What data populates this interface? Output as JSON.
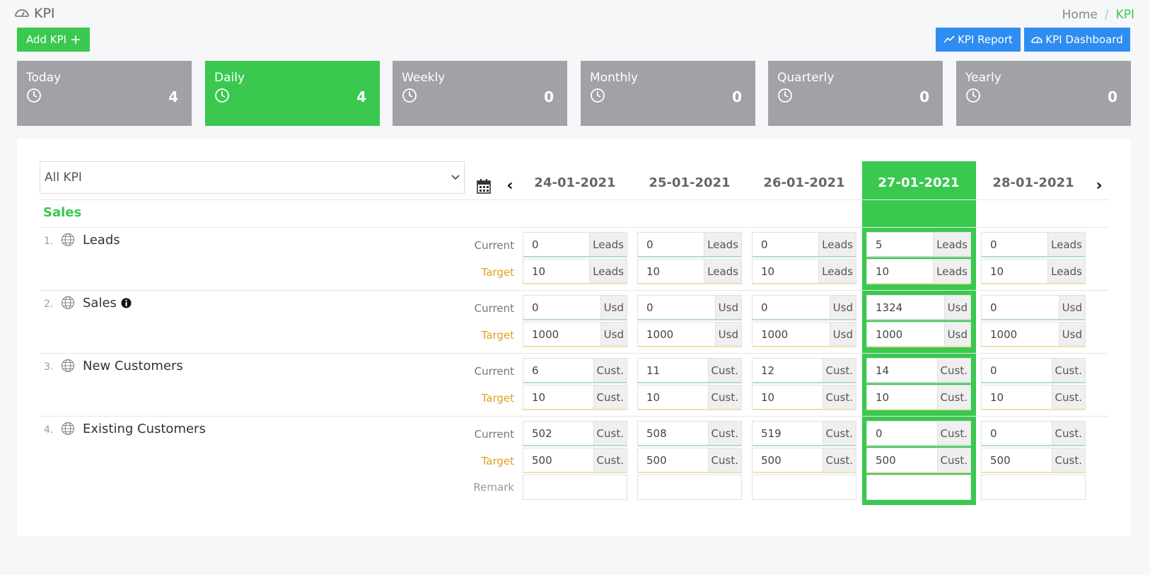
{
  "header": {
    "title": "KPI",
    "title_icon": "dashboard-gauge-icon"
  },
  "breadcrumb": {
    "home": "Home",
    "separator": "/",
    "current": "KPI"
  },
  "buttons": {
    "add_kpi": "Add KPI",
    "kpi_report": "KPI Report",
    "kpi_dashboard": "KPI Dashboard"
  },
  "periods": [
    {
      "label": "Today",
      "count": "4",
      "active": false
    },
    {
      "label": "Daily",
      "count": "4",
      "active": true
    },
    {
      "label": "Weekly",
      "count": "0",
      "active": false
    },
    {
      "label": "Monthly",
      "count": "0",
      "active": false
    },
    {
      "label": "Quarterly",
      "count": "0",
      "active": false
    },
    {
      "label": "Yearly",
      "count": "0",
      "active": false
    }
  ],
  "filter": {
    "selected": "All KPI"
  },
  "dates": [
    "24-01-2021",
    "25-01-2021",
    "26-01-2021",
    "27-01-2021",
    "28-01-2021"
  ],
  "active_date_index": 3,
  "section": "Sales",
  "row_labels": {
    "current": "Current",
    "target": "Target",
    "remark": "Remark"
  },
  "kpis": [
    {
      "num": "1.",
      "name": "Leads",
      "info": false,
      "unit": "Leads",
      "current": [
        "0",
        "0",
        "0",
        "5",
        "0"
      ],
      "target": [
        "10",
        "10",
        "10",
        "10",
        "10"
      ]
    },
    {
      "num": "2.",
      "name": "Sales",
      "info": true,
      "unit": "Usd",
      "current": [
        "0",
        "0",
        "0",
        "1324",
        "0"
      ],
      "target": [
        "1000",
        "1000",
        "1000",
        "1000",
        "1000"
      ]
    },
    {
      "num": "3.",
      "name": "New Customers",
      "info": false,
      "unit": "Cust.",
      "current": [
        "6",
        "11",
        "12",
        "14",
        "0"
      ],
      "target": [
        "10",
        "10",
        "10",
        "10",
        "10"
      ]
    },
    {
      "num": "4.",
      "name": "Existing Customers",
      "info": false,
      "unit": "Cust.",
      "current": [
        "502",
        "508",
        "519",
        "0",
        "0"
      ],
      "target": [
        "500",
        "500",
        "500",
        "500",
        "500"
      ]
    }
  ],
  "colors": {
    "green": "#3ac84f",
    "blue": "#2f8cf0",
    "card_gray": "#a0a2a6",
    "target_orange": "#e0a020"
  }
}
